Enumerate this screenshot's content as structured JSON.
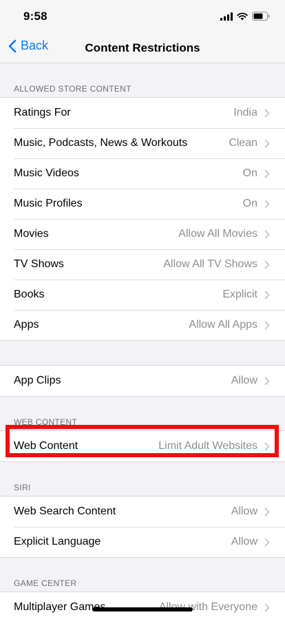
{
  "status_bar": {
    "time": "9:58"
  },
  "nav": {
    "back_label": "Back",
    "title": "Content Restrictions"
  },
  "sections": {
    "store_header": "ALLOWED STORE CONTENT",
    "web_header": "WEB CONTENT",
    "siri_header": "SIRI",
    "game_header": "GAME CENTER"
  },
  "store_rows": [
    {
      "label": "Ratings For",
      "value": "India"
    },
    {
      "label": "Music, Podcasts, News & Workouts",
      "value": "Clean"
    },
    {
      "label": "Music Videos",
      "value": "On"
    },
    {
      "label": "Music Profiles",
      "value": "On"
    },
    {
      "label": "Movies",
      "value": "Allow All Movies"
    },
    {
      "label": "TV Shows",
      "value": "Allow All TV Shows"
    },
    {
      "label": "Books",
      "value": "Explicit"
    },
    {
      "label": "Apps",
      "value": "Allow All Apps"
    }
  ],
  "app_clips": {
    "label": "App Clips",
    "value": "Allow"
  },
  "web_content": {
    "label": "Web Content",
    "value": "Limit Adult Websites"
  },
  "siri_rows": [
    {
      "label": "Web Search Content",
      "value": "Allow"
    },
    {
      "label": "Explicit Language",
      "value": "Allow"
    }
  ],
  "game_rows": [
    {
      "label": "Multiplayer Games",
      "value": "Allow with Everyone"
    }
  ],
  "colors": {
    "accent": "#0a7aff",
    "highlight": "#f20d0d",
    "secondary_text": "#8e8e93",
    "background": "#f2f2f7"
  },
  "icons": [
    "signal-icon",
    "wifi-icon",
    "battery-icon",
    "back-chevron-icon",
    "chevron-right-icon"
  ]
}
